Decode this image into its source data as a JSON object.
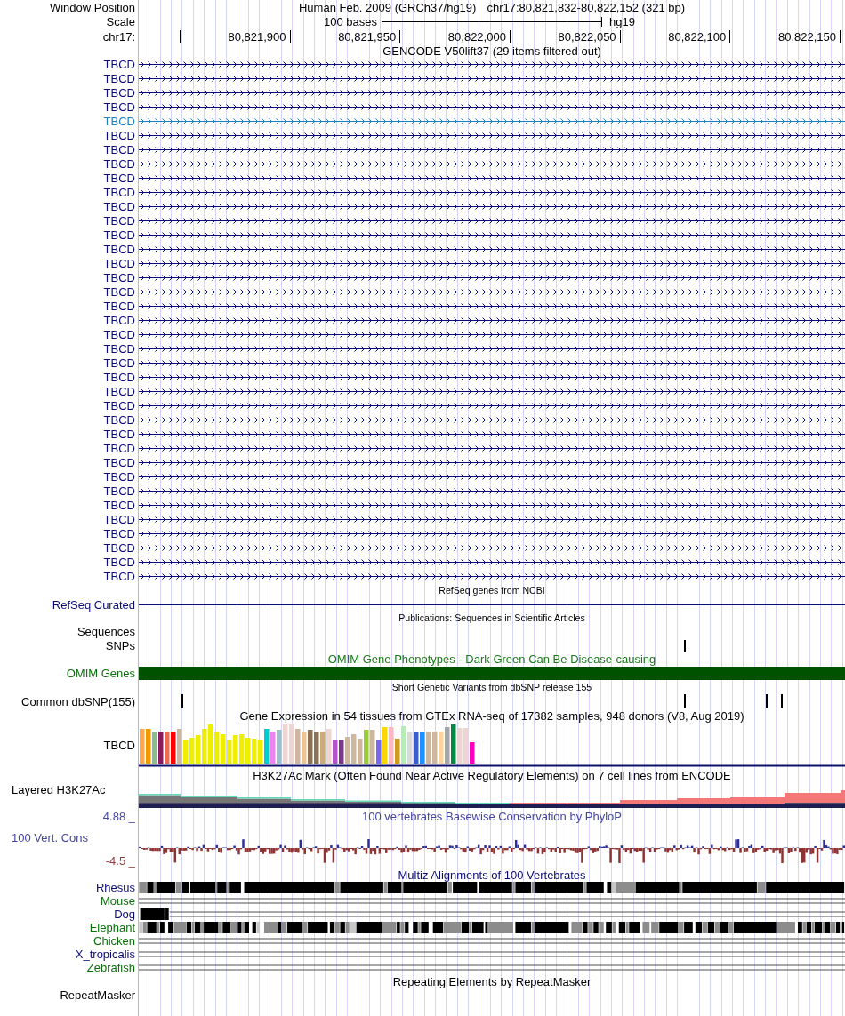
{
  "position": {
    "label": "Window Position",
    "assembly": "Human Feb. 2009 (GRCh37/hg19)",
    "range": "chr17:80,821,832-80,822,152 (321 bp)"
  },
  "scale": {
    "label": "Scale",
    "length": "100 bases",
    "assembly": "hg19"
  },
  "ruler": {
    "label": "chr17:",
    "ticks": [
      "80,821,900",
      "80,821,950",
      "80,822,000",
      "80,822,050",
      "80,822,100",
      "80,822,150"
    ]
  },
  "tracks": [
    {
      "kind": "genes",
      "title": "GENCODE V50lift37 (29 items filtered out)",
      "items": [
        {
          "label": "TBCD",
          "color": "#0c0c78"
        },
        {
          "label": "TBCD",
          "color": "#0c0c78"
        },
        {
          "label": "TBCD",
          "color": "#0c0c78"
        },
        {
          "label": "TBCD",
          "color": "#0c0c78"
        },
        {
          "label": "TBCD",
          "color": "#1f80c0"
        },
        {
          "label": "TBCD",
          "color": "#0c0c78"
        },
        {
          "label": "TBCD",
          "color": "#0c0c78"
        },
        {
          "label": "TBCD",
          "color": "#0c0c78"
        },
        {
          "label": "TBCD",
          "color": "#0c0c78"
        },
        {
          "label": "TBCD",
          "color": "#0c0c78"
        },
        {
          "label": "TBCD",
          "color": "#0c0c78"
        },
        {
          "label": "TBCD",
          "color": "#0c0c78"
        },
        {
          "label": "TBCD",
          "color": "#0c0c78"
        },
        {
          "label": "TBCD",
          "color": "#0c0c78"
        },
        {
          "label": "TBCD",
          "color": "#0c0c78"
        },
        {
          "label": "TBCD",
          "color": "#0c0c78"
        },
        {
          "label": "TBCD",
          "color": "#0c0c78"
        },
        {
          "label": "TBCD",
          "color": "#0c0c78"
        },
        {
          "label": "TBCD",
          "color": "#0c0c78"
        },
        {
          "label": "TBCD",
          "color": "#0c0c78"
        },
        {
          "label": "TBCD",
          "color": "#0c0c78"
        },
        {
          "label": "TBCD",
          "color": "#0c0c78"
        },
        {
          "label": "TBCD",
          "color": "#0c0c78"
        },
        {
          "label": "TBCD",
          "color": "#0c0c78"
        },
        {
          "label": "TBCD",
          "color": "#0c0c78"
        },
        {
          "label": "TBCD",
          "color": "#0c0c78"
        },
        {
          "label": "TBCD",
          "color": "#0c0c78"
        },
        {
          "label": "TBCD",
          "color": "#0c0c78"
        },
        {
          "label": "TBCD",
          "color": "#0c0c78"
        },
        {
          "label": "TBCD",
          "color": "#0c0c78"
        },
        {
          "label": "TBCD",
          "color": "#0c0c78"
        },
        {
          "label": "TBCD",
          "color": "#0c0c78"
        },
        {
          "label": "TBCD",
          "color": "#0c0c78"
        },
        {
          "label": "TBCD",
          "color": "#0c0c78"
        },
        {
          "label": "TBCD",
          "color": "#0c0c78"
        },
        {
          "label": "TBCD",
          "color": "#0c0c78"
        },
        {
          "label": "TBCD",
          "color": "#0c0c78"
        }
      ]
    },
    {
      "kind": "line",
      "title": "RefSeq genes from NCBI",
      "label": "RefSeq Curated",
      "color": "#0c0c78"
    },
    {
      "kind": "publications",
      "title": "Publications: Sequences in Scientific Articles",
      "rows": [
        {
          "label": "Sequences"
        },
        {
          "label": "SNPs"
        }
      ]
    },
    {
      "kind": "bar",
      "title": "OMIM Gene Phenotypes - Dark Green Can Be Disease-causing",
      "label": "OMIM Genes",
      "color": "#0c700c"
    },
    {
      "kind": "variants",
      "title": "Short Genetic Variants from dbSNP release 155",
      "label": "Common dbSNP(155)"
    },
    {
      "kind": "expression",
      "title": "Gene Expression in 54 tissues from GTEx RNA-seq of 17382 samples, 948 donors (V8, Aug 2019)",
      "label": "TBCD"
    },
    {
      "kind": "layered",
      "title": "H3K27Ac Mark (Often Found Near Active Regulatory Elements) on 7 cell lines from ENCODE",
      "label": "Layered H3K27Ac"
    },
    {
      "kind": "wiggle",
      "title": "100 vertebrates Basewise Conservation by PhyloP",
      "label": "100 Vert. Cons",
      "color": "#4646a0",
      "max": "4.88 _",
      "min": "-4.5 _"
    },
    {
      "kind": "multiz",
      "title": "Multiz Alignments of 100 Vertebrates",
      "species": [
        {
          "name": "Rhesus",
          "kind": "aligned",
          "color": "#0c0c78"
        },
        {
          "name": "Mouse",
          "kind": "unaligned",
          "color": "#0c700c"
        },
        {
          "name": "Dog",
          "kind": "partial",
          "color": "#0c0c78"
        },
        {
          "name": "Elephant",
          "kind": "aligned",
          "color": "#0c700c"
        },
        {
          "name": "Chicken",
          "kind": "unaligned",
          "color": "#0c700c"
        },
        {
          "name": "X_tropicalis",
          "kind": "unaligned",
          "color": "#0c0c78"
        },
        {
          "name": "Zebrafish",
          "kind": "unaligned",
          "color": "#0c700c"
        }
      ]
    },
    {
      "kind": "repeats",
      "title": "Repeating Elements by RepeatMasker",
      "label": "RepeatMasker"
    }
  ]
}
